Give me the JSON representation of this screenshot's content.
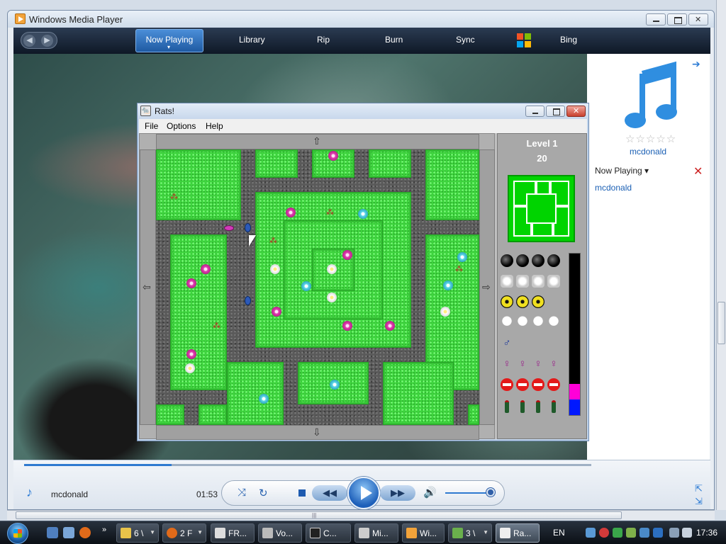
{
  "wmp": {
    "title": "Windows Media Player",
    "tabs": [
      "Now Playing",
      "Library",
      "Rip",
      "Burn",
      "Sync",
      "Bing"
    ],
    "right_panel": {
      "album": "mcdonald",
      "now_playing_label": "Now Playing",
      "list_item": "mcdonald",
      "stars": "☆☆☆☆☆"
    },
    "controls": {
      "track": "mcdonald",
      "time": "01:53",
      "seek_progress_percent": 26
    }
  },
  "rats": {
    "title": "Rats!",
    "menu": [
      "File",
      "Options",
      "Help"
    ],
    "level_label": "Level 1",
    "score": "20"
  },
  "taskbar": {
    "buttons": [
      "6 \\",
      "2 F",
      "FR...",
      "Vo...",
      "C...",
      "Mi...",
      "Wi...",
      "3 \\",
      "Ra..."
    ],
    "language": "EN",
    "clock": "17:36"
  },
  "colors": {
    "grass": "#3fd63f",
    "path": "#5a5a5a",
    "wmp_accent": "#2c7bd4"
  },
  "icons": {
    "tools": [
      "bomb-icon",
      "gas-icon",
      "radiation-icon",
      "poison-icon",
      "male-icon",
      "female-icon",
      "stop-sign-icon",
      "bottle-icon"
    ]
  }
}
